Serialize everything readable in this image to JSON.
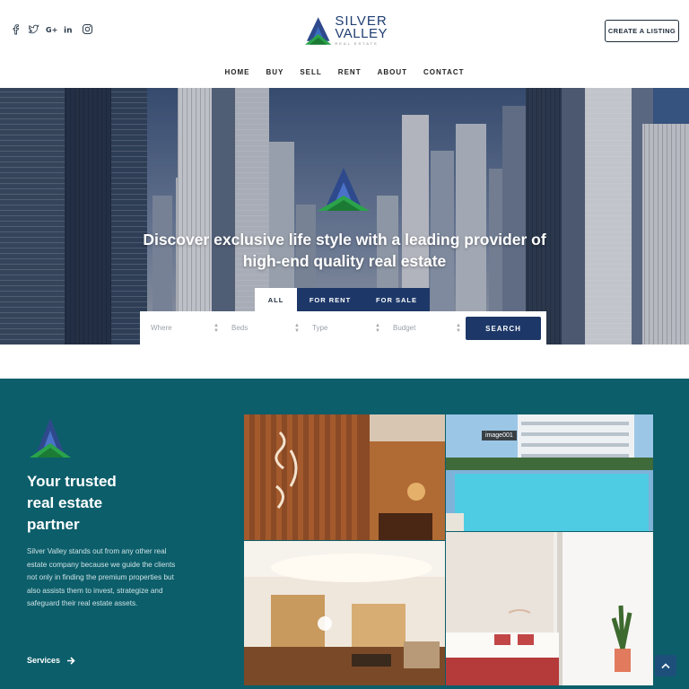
{
  "header": {
    "social": [
      "facebook-icon",
      "twitter-icon",
      "google-plus-icon",
      "linkedin-icon",
      "instagram-icon"
    ],
    "logo": {
      "line1": "SILVER",
      "line2": "VALLEY",
      "line3": "REAL ESTATE"
    },
    "create_listing_label": "CREATE A LISTING"
  },
  "nav": {
    "items": [
      "HOME",
      "BUY",
      "SELL",
      "RENT",
      "ABOUT",
      "CONTACT"
    ]
  },
  "hero": {
    "title_line1": "Discover exclusive life style with a leading provider of",
    "title_line2": "high-end quality real estate",
    "tabs": [
      "ALL",
      "FOR RENT",
      "FOR SALE"
    ],
    "active_tab": "ALL",
    "filters": [
      {
        "placeholder": "Where"
      },
      {
        "placeholder": "Beds"
      },
      {
        "placeholder": "Type"
      },
      {
        "placeholder": "Budget"
      }
    ],
    "search_label": "SEARCH"
  },
  "about": {
    "title_line1": "Your trusted",
    "title_line2": "real estate",
    "title_line3": "partner",
    "text": "Silver Valley stands out from any other real estate company because we guide the clients not only in finding the premium properties but also assists them to invest, strategize and safeguard their real estate assets.",
    "link_label": "Services",
    "gallery_tag": "image001"
  },
  "colors": {
    "brand_navy": "#1d3868",
    "teal": "#0c5e6a",
    "logo_green": "#2aa34a",
    "logo_blue": "#2e4a8c"
  }
}
